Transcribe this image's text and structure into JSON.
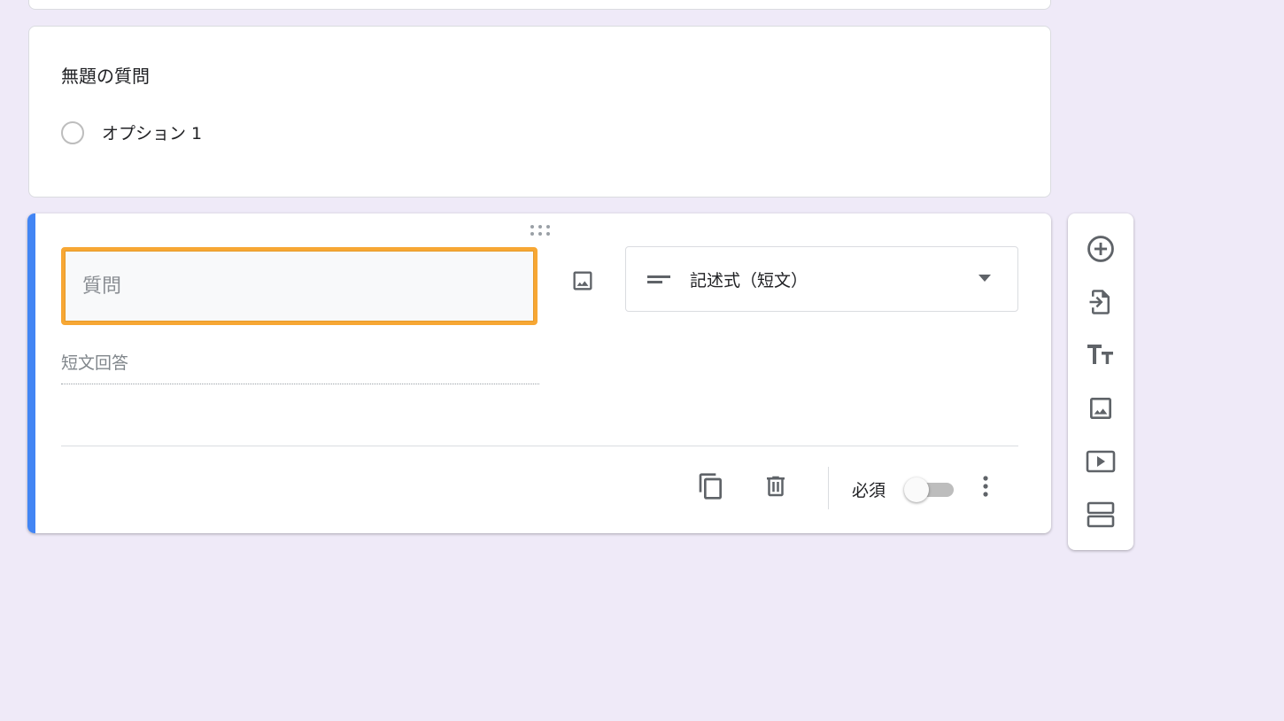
{
  "colors": {
    "background": "#efeaf8",
    "card": "#ffffff",
    "accent": "#4285f4",
    "focus_outline": "#f7a734",
    "icon": "#5f6368"
  },
  "question1": {
    "title": "無題の質問",
    "option_label": "オプション 1"
  },
  "question2": {
    "title_placeholder": "質問",
    "type_select": {
      "icon": "short-text-icon",
      "label": "記述式（短文）"
    },
    "short_answer_placeholder": "短文回答",
    "required_label": "必須",
    "required_on": false
  },
  "toolbar": {
    "items": [
      {
        "icon": "add-circle-icon",
        "action": "add-question"
      },
      {
        "icon": "import-icon",
        "action": "import-questions"
      },
      {
        "icon": "title-icon",
        "action": "add-title"
      },
      {
        "icon": "image-icon",
        "action": "add-image"
      },
      {
        "icon": "video-icon",
        "action": "add-video"
      },
      {
        "icon": "section-icon",
        "action": "add-section"
      }
    ]
  }
}
